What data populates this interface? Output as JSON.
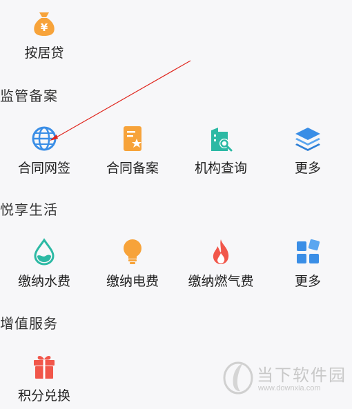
{
  "top_item": {
    "label": "按居贷",
    "icon": "money-bag-icon"
  },
  "sections": [
    {
      "title": "监管备案",
      "items": [
        {
          "label": "合同网签",
          "icon": "globe-icon"
        },
        {
          "label": "合同备案",
          "icon": "document-star-icon"
        },
        {
          "label": "机构查询",
          "icon": "building-search-icon"
        },
        {
          "label": "更多",
          "icon": "layers-icon"
        }
      ]
    },
    {
      "title": "悦享生活",
      "items": [
        {
          "label": "缴纳水费",
          "icon": "water-drop-icon"
        },
        {
          "label": "缴纳电费",
          "icon": "light-bulb-icon"
        },
        {
          "label": "缴纳燃气费",
          "icon": "flame-icon"
        },
        {
          "label": "更多",
          "icon": "app-grid-icon"
        }
      ]
    },
    {
      "title": "增值服务",
      "items": [
        {
          "label": "积分兑换",
          "icon": "gift-icon"
        }
      ]
    }
  ],
  "watermark": {
    "name": "当下软件园",
    "url": "www.downxia.com"
  },
  "colors": {
    "orange": "#f7a33a",
    "blue": "#3a8ee6",
    "teal": "#2cb9a4",
    "red": "#f1564a",
    "annotation": "#e0261e"
  }
}
